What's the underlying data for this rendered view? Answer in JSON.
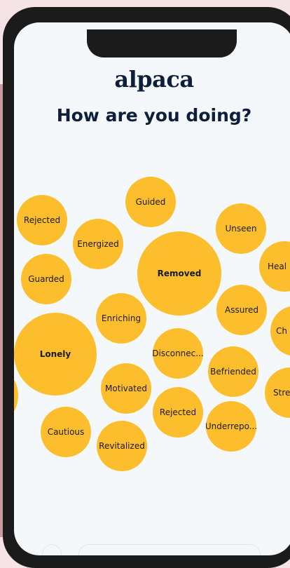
{
  "app": {
    "logo": "alpaca",
    "title": "How are you doing?"
  },
  "colors": {
    "bubble": "#fdbe2d",
    "title": "#0f1f3b",
    "screen_bg": "#f4f8fa"
  },
  "feelings": [
    "Guided",
    "Rejected",
    "Energized",
    "Unseen",
    "Removed",
    "Heal",
    "Guarded",
    "Assured",
    "Enriching",
    "Ch",
    "Lonely",
    "Disconnec...",
    "Befriended",
    "Motivated",
    "Stre",
    "Rejected",
    "Cautious",
    "Underrepo...",
    "Revitalized"
  ]
}
